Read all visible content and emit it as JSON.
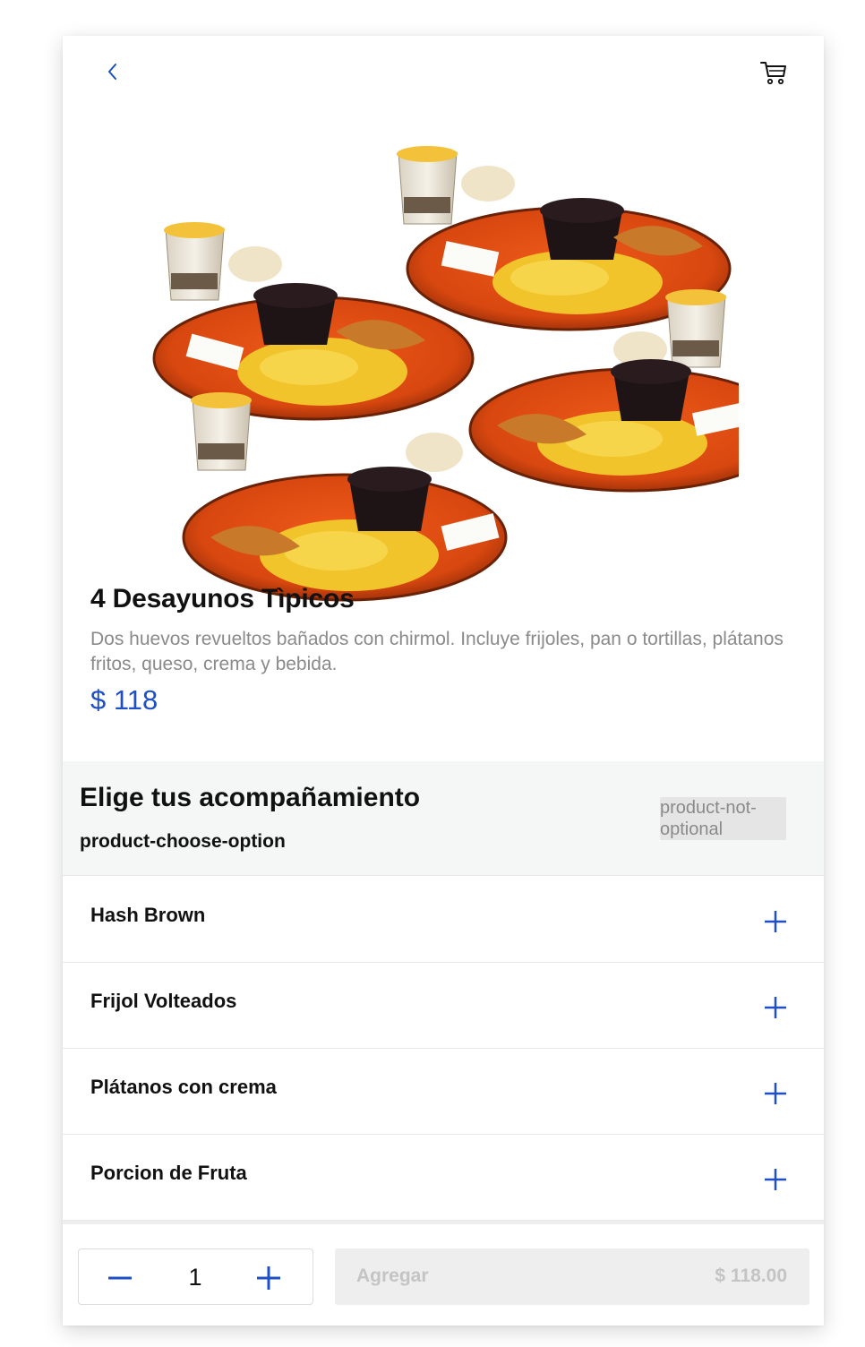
{
  "header": {
    "back_icon": "chevron-left-icon",
    "cart_icon": "cart-icon",
    "accent_color": "#1f4fc4"
  },
  "product": {
    "image_icon": "breakfast-plates-image",
    "title": "4 Desayunos Tìpicos",
    "description": "Dos huevos revueltos bañados con chirmol. Incluye frijoles, pan o tortillas, plátanos fritos, queso, crema y bebida.",
    "price": "$ 118"
  },
  "options": {
    "title": "Elige tus acompañamiento",
    "subtitle": "product-choose-option",
    "badge": "product-not-optional",
    "items": [
      {
        "label": "Hash Brown",
        "icon": "plus-icon"
      },
      {
        "label": "Frijol Volteados",
        "icon": "plus-icon"
      },
      {
        "label": "Plátanos con crema",
        "icon": "plus-icon"
      },
      {
        "label": "Porcion de Fruta",
        "icon": "plus-icon"
      }
    ]
  },
  "footer": {
    "quantity": "1",
    "minus_icon": "minus-icon",
    "plus_icon": "plus-icon",
    "add_label": "Agregar",
    "add_price": "$ 118.00"
  }
}
